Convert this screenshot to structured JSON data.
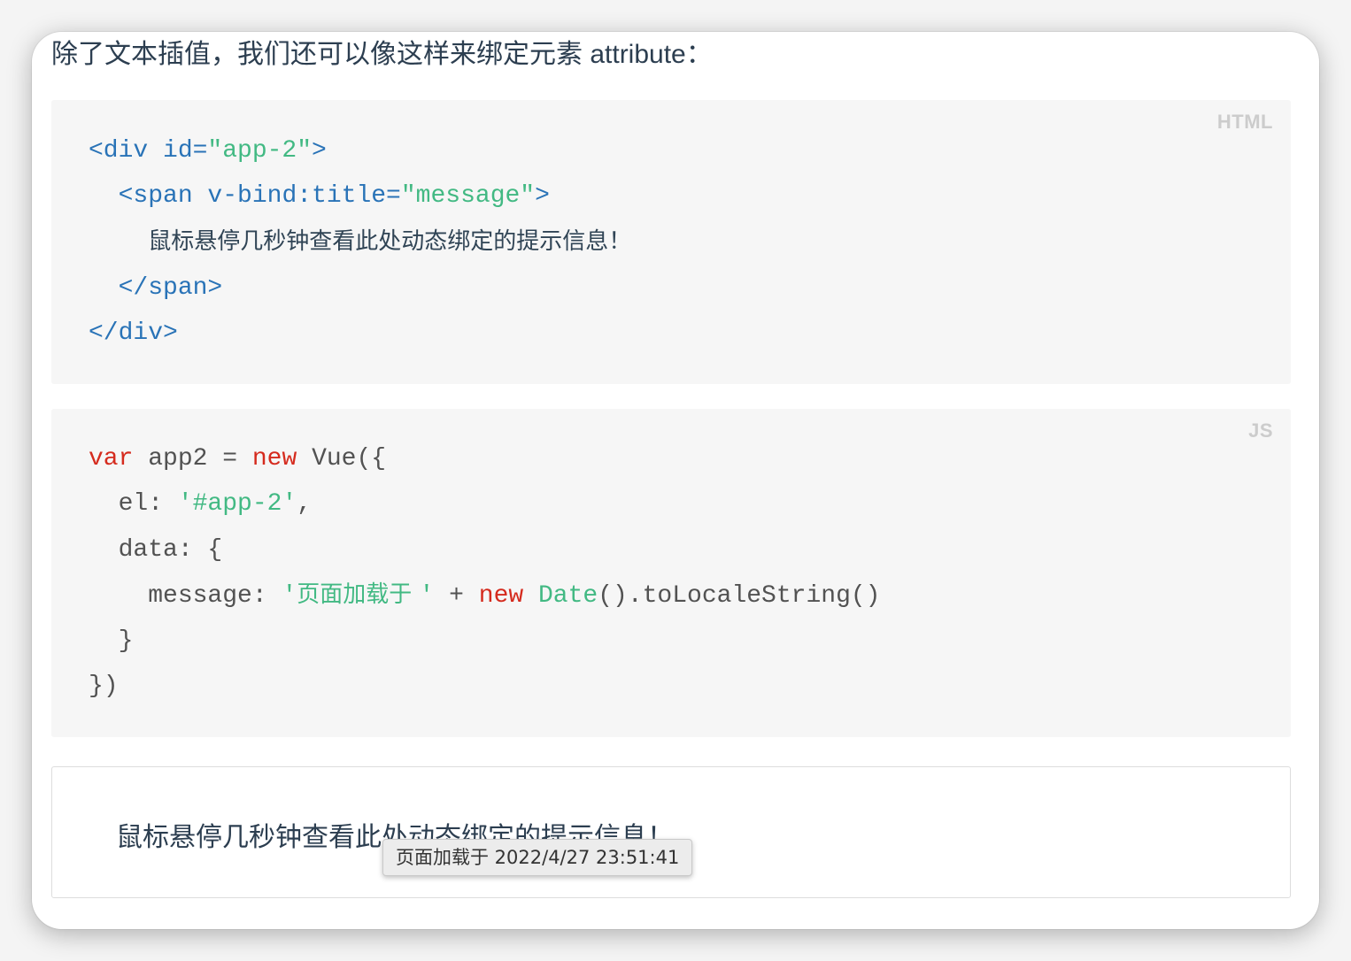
{
  "intro": {
    "text": "除了文本插值，我们还可以像这样来绑定元素 attribute："
  },
  "html_block": {
    "lang": "HTML",
    "line1": {
      "open": "<div id=",
      "attr_value": "\"app-2\"",
      "close": ">"
    },
    "line2": {
      "indent": "  ",
      "open": "<span v-bind:title=",
      "attr_value": "\"message\"",
      "close": ">"
    },
    "line3": {
      "indent": "    ",
      "text": "鼠标悬停几秒钟查看此处动态绑定的提示信息！"
    },
    "line4": {
      "indent": "  ",
      "tag": "</span>"
    },
    "line5": {
      "tag": "</div>"
    }
  },
  "js_block": {
    "lang": "JS",
    "line1": {
      "kw_var": "var",
      "mid": " app2 = ",
      "kw_new": "new",
      "rest": " Vue({"
    },
    "line2": {
      "indent": "  ",
      "key": "el: ",
      "value": "'#app-2'",
      "rest": ","
    },
    "line3": {
      "indent": "  ",
      "text": "data: {"
    },
    "line4": {
      "indent": "    ",
      "key": "message: ",
      "str_open": "'",
      "str_text": "页面加载于 ",
      "str_close": "'",
      "plus": " + ",
      "kw_new": "new",
      "space": " ",
      "date_fn": "Date",
      "rest": "().toLocaleString()"
    },
    "line5": {
      "indent": "  ",
      "text": "}"
    },
    "line6": {
      "text": "})"
    }
  },
  "demo": {
    "text": "鼠标悬停几秒钟查看此处动态绑定的提示信息！"
  },
  "tooltip": {
    "text": "页面加载于 2022/4/27 23:51:41"
  }
}
